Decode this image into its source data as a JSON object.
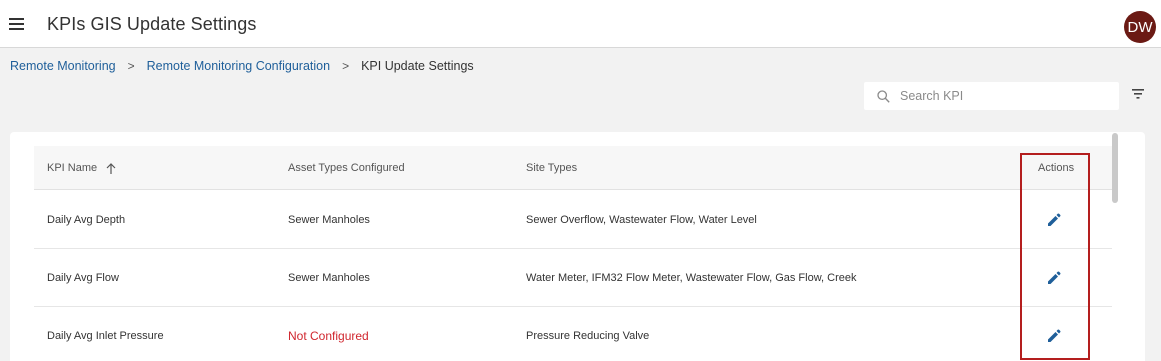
{
  "header": {
    "title": "KPIs GIS Update Settings",
    "avatar_initials": "DW",
    "avatar_color": "#6b1a14"
  },
  "breadcrumb": {
    "items": [
      "Remote Monitoring",
      "Remote Monitoring Configuration"
    ],
    "current": "KPI Update Settings",
    "separator": ">"
  },
  "search": {
    "placeholder": "Search KPI",
    "value": ""
  },
  "table": {
    "columns": {
      "kpi_name": "KPI Name",
      "asset_types": "Asset Types Configured",
      "site_types": "Site Types",
      "actions": "Actions"
    },
    "sort": {
      "column": "KPI Name",
      "direction": "ascending"
    },
    "rows": [
      {
        "kpi_name": "Daily Avg Depth",
        "asset_types": "Sewer Manholes",
        "site_types": "Sewer Overflow, Wastewater Flow, Water Level",
        "action_icon": "edit-icon"
      },
      {
        "kpi_name": "Daily Avg Flow",
        "asset_types": "Sewer Manholes",
        "site_types": "Water Meter, IFM32 Flow Meter, Wastewater Flow, Gas Flow, Creek",
        "action_icon": "edit-icon"
      },
      {
        "kpi_name": "Daily Avg Inlet Pressure",
        "asset_types": "Not Configured",
        "site_types": "Pressure Reducing Valve",
        "action_icon": "edit-icon"
      }
    ]
  },
  "colors": {
    "link": "#1f5f9a",
    "not_configured": "#d0262e",
    "edit_icon": "#1f5f9a",
    "highlight_border": "#b41e1e"
  }
}
